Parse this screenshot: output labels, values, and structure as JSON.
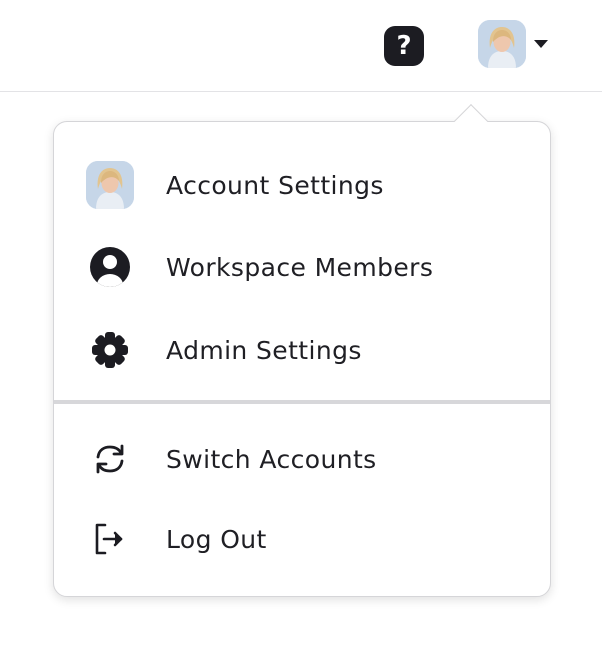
{
  "header": {
    "help_glyph": "?",
    "help_icon": "question-mark-icon",
    "avatar_icon": "user-avatar-photo",
    "caret_icon": "caret-down-icon"
  },
  "menu": {
    "primary_items": [
      {
        "label": "Account Settings",
        "icon": "user-avatar-photo"
      },
      {
        "label": "Workspace Members",
        "icon": "person-circle-icon"
      },
      {
        "label": "Admin Settings",
        "icon": "gear-icon"
      }
    ],
    "secondary_items": [
      {
        "label": "Switch Accounts",
        "icon": "refresh-arrows-icon"
      },
      {
        "label": "Log Out",
        "icon": "log-out-icon"
      }
    ]
  },
  "colors": {
    "text": "#1f1f24",
    "icon_dark": "#1c1c22",
    "divider": "#d7d7da",
    "border": "#d5d5d8"
  }
}
